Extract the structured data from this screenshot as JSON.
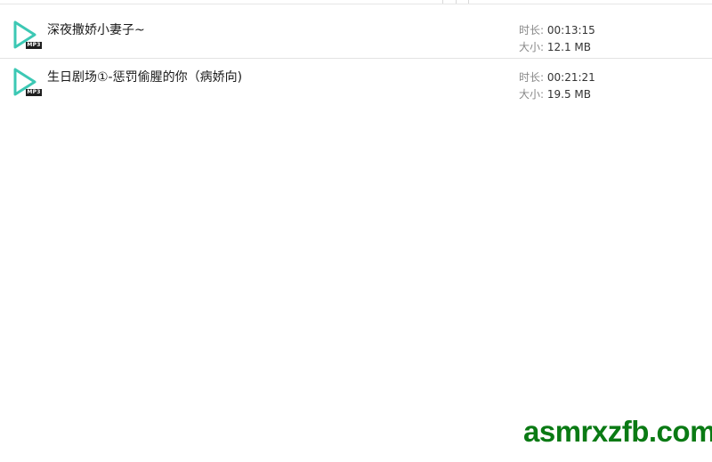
{
  "files": [
    {
      "name": "深夜撒娇小妻子~",
      "badge": "MP3",
      "duration_label": "时长:",
      "duration": "00:13:15",
      "size_label": "大小:",
      "size": "12.1 MB"
    },
    {
      "name": "生日剧场①-惩罚偷腥的你（病娇向)",
      "badge": "MP3",
      "duration_label": "时长:",
      "duration": "00:21:21",
      "size_label": "大小:",
      "size": "19.5 MB"
    }
  ],
  "icon": "audio-mp3-icon",
  "colors": {
    "icon_teal": "#3cc8b4",
    "watermark_green": "#0a7a14"
  },
  "watermark": "asmrxzfb.com"
}
